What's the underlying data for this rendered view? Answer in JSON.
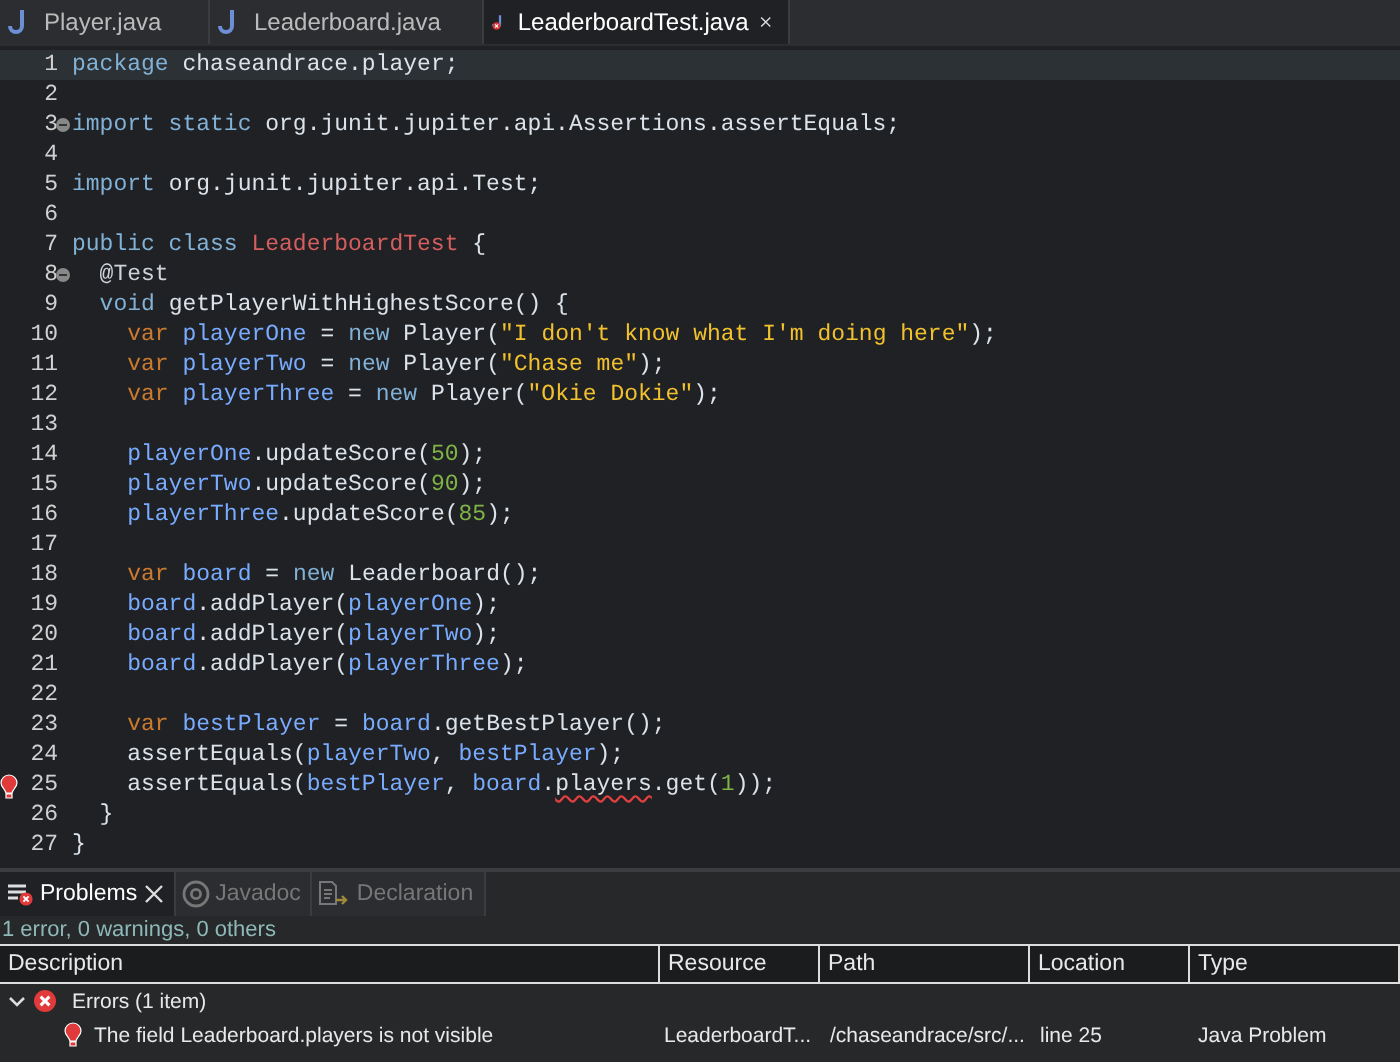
{
  "editor_tabs": [
    {
      "label": "Player.java",
      "selected": false,
      "has_error": false
    },
    {
      "label": "Leaderboard.java",
      "selected": false,
      "has_error": false
    },
    {
      "label": "LeaderboardTest.java",
      "selected": true,
      "has_error": true
    }
  ],
  "code_lines": [
    {
      "no": "1",
      "current": true,
      "foldable": false,
      "has_error": false,
      "tokens": [
        {
          "t": "package ",
          "kind": "keyword"
        },
        {
          "t": "chaseandrace.player;",
          "kind": "plain"
        }
      ]
    },
    {
      "no": "2",
      "current": false,
      "foldable": false,
      "has_error": false
    },
    {
      "no": "3",
      "current": false,
      "foldable": true,
      "has_error": false,
      "tokens": [
        {
          "t": "import static ",
          "kind": "keyword"
        },
        {
          "t": "org.junit.jupiter.api.Assertions.assertEquals;",
          "kind": "plain"
        }
      ]
    },
    {
      "no": "4",
      "current": false,
      "foldable": false,
      "has_error": false
    },
    {
      "no": "5",
      "current": false,
      "foldable": false,
      "has_error": false,
      "tokens": [
        {
          "t": "import ",
          "kind": "keyword"
        },
        {
          "t": "org.junit.jupiter.api.Test;",
          "kind": "plain"
        }
      ]
    },
    {
      "no": "6",
      "current": false,
      "foldable": false,
      "has_error": false
    },
    {
      "no": "7",
      "current": false,
      "foldable": false,
      "has_error": false,
      "tokens": [
        {
          "t": "public class ",
          "kind": "keyword"
        },
        {
          "t": "LeaderboardTest",
          "kind": "class"
        },
        {
          "t": " {",
          "kind": "plain"
        }
      ]
    },
    {
      "no": "8",
      "current": false,
      "foldable": true,
      "has_error": false,
      "tokens": [
        {
          "t": "  @Test",
          "kind": "annotation"
        }
      ]
    },
    {
      "no": "9",
      "current": false,
      "foldable": false,
      "has_error": false,
      "tokens": [
        {
          "t": "  void ",
          "kind": "keyword"
        },
        {
          "t": "getPlayerWithHighestScore() {",
          "kind": "plain"
        }
      ]
    },
    {
      "no": "10",
      "current": false,
      "foldable": false,
      "has_error": false,
      "tokens": [
        {
          "t": "    var ",
          "kind": "var"
        },
        {
          "t": "playerOne",
          "kind": "local"
        },
        {
          "t": " = ",
          "kind": "plain"
        },
        {
          "t": "new ",
          "kind": "keyword"
        },
        {
          "t": "Player(",
          "kind": "plain"
        },
        {
          "t": "\"I don't know what I'm doing here\"",
          "kind": "string"
        },
        {
          "t": ");",
          "kind": "plain"
        }
      ]
    },
    {
      "no": "11",
      "current": false,
      "foldable": false,
      "has_error": false,
      "tokens": [
        {
          "t": "    var ",
          "kind": "var"
        },
        {
          "t": "playerTwo",
          "kind": "local"
        },
        {
          "t": " = ",
          "kind": "plain"
        },
        {
          "t": "new ",
          "kind": "keyword"
        },
        {
          "t": "Player(",
          "kind": "plain"
        },
        {
          "t": "\"Chase me\"",
          "kind": "string"
        },
        {
          "t": ");",
          "kind": "plain"
        }
      ]
    },
    {
      "no": "12",
      "current": false,
      "foldable": false,
      "has_error": false,
      "tokens": [
        {
          "t": "    var ",
          "kind": "var"
        },
        {
          "t": "playerThree",
          "kind": "local"
        },
        {
          "t": " = ",
          "kind": "plain"
        },
        {
          "t": "new ",
          "kind": "keyword"
        },
        {
          "t": "Player(",
          "kind": "plain"
        },
        {
          "t": "\"Okie Dokie\"",
          "kind": "string"
        },
        {
          "t": ");",
          "kind": "plain"
        }
      ]
    },
    {
      "no": "13",
      "current": false,
      "foldable": false,
      "has_error": false
    },
    {
      "no": "14",
      "current": false,
      "foldable": false,
      "has_error": false,
      "tokens": [
        {
          "t": "    playerOne",
          "kind": "local"
        },
        {
          "t": ".updateScore(",
          "kind": "plain"
        },
        {
          "t": "50",
          "kind": "number"
        },
        {
          "t": ");",
          "kind": "plain"
        }
      ]
    },
    {
      "no": "15",
      "current": false,
      "foldable": false,
      "has_error": false,
      "tokens": [
        {
          "t": "    playerTwo",
          "kind": "local"
        },
        {
          "t": ".updateScore(",
          "kind": "plain"
        },
        {
          "t": "90",
          "kind": "number"
        },
        {
          "t": ");",
          "kind": "plain"
        }
      ]
    },
    {
      "no": "16",
      "current": false,
      "foldable": false,
      "has_error": false,
      "tokens": [
        {
          "t": "    playerThree",
          "kind": "local"
        },
        {
          "t": ".updateScore(",
          "kind": "plain"
        },
        {
          "t": "85",
          "kind": "number"
        },
        {
          "t": ");",
          "kind": "plain"
        }
      ]
    },
    {
      "no": "17",
      "current": false,
      "foldable": false,
      "has_error": false
    },
    {
      "no": "18",
      "current": false,
      "foldable": false,
      "has_error": false,
      "tokens": [
        {
          "t": "    var ",
          "kind": "var"
        },
        {
          "t": "board",
          "kind": "local"
        },
        {
          "t": " = ",
          "kind": "plain"
        },
        {
          "t": "new ",
          "kind": "keyword"
        },
        {
          "t": "Leaderboard();",
          "kind": "plain"
        }
      ]
    },
    {
      "no": "19",
      "current": false,
      "foldable": false,
      "has_error": false,
      "tokens": [
        {
          "t": "    board",
          "kind": "local"
        },
        {
          "t": ".addPlayer(",
          "kind": "plain"
        },
        {
          "t": "playerOne",
          "kind": "local"
        },
        {
          "t": ");",
          "kind": "plain"
        }
      ]
    },
    {
      "no": "20",
      "current": false,
      "foldable": false,
      "has_error": false,
      "tokens": [
        {
          "t": "    board",
          "kind": "local"
        },
        {
          "t": ".addPlayer(",
          "kind": "plain"
        },
        {
          "t": "playerTwo",
          "kind": "local"
        },
        {
          "t": ");",
          "kind": "plain"
        }
      ]
    },
    {
      "no": "21",
      "current": false,
      "foldable": false,
      "has_error": false,
      "tokens": [
        {
          "t": "    board",
          "kind": "local"
        },
        {
          "t": ".addPlayer(",
          "kind": "plain"
        },
        {
          "t": "playerThree",
          "kind": "local"
        },
        {
          "t": ");",
          "kind": "plain"
        }
      ]
    },
    {
      "no": "22",
      "current": false,
      "foldable": false,
      "has_error": false
    },
    {
      "no": "23",
      "current": false,
      "foldable": false,
      "has_error": false,
      "tokens": [
        {
          "t": "    var ",
          "kind": "var"
        },
        {
          "t": "bestPlayer",
          "kind": "local"
        },
        {
          "t": " = ",
          "kind": "plain"
        },
        {
          "t": "board",
          "kind": "local"
        },
        {
          "t": ".getBestPlayer();",
          "kind": "plain"
        }
      ]
    },
    {
      "no": "24",
      "current": false,
      "foldable": false,
      "has_error": false,
      "tokens": [
        {
          "t": "    assertEquals(",
          "kind": "plain"
        },
        {
          "t": "playerTwo",
          "kind": "local"
        },
        {
          "t": ", ",
          "kind": "plain"
        },
        {
          "t": "bestPlayer",
          "kind": "local"
        },
        {
          "t": ");",
          "kind": "plain"
        }
      ]
    },
    {
      "no": "25",
      "current": false,
      "foldable": false,
      "has_error": true,
      "tokens": [
        {
          "t": "    assertEquals(",
          "kind": "plain"
        },
        {
          "t": "bestPlayer",
          "kind": "local"
        },
        {
          "t": ", ",
          "kind": "plain"
        },
        {
          "t": "board",
          "kind": "local"
        },
        {
          "t": ".",
          "kind": "plain"
        },
        {
          "t": "players",
          "kind": "error"
        },
        {
          "t": ".get(",
          "kind": "plain"
        },
        {
          "t": "1",
          "kind": "number"
        },
        {
          "t": "));",
          "kind": "plain"
        }
      ]
    },
    {
      "no": "26",
      "current": false,
      "foldable": false,
      "has_error": false,
      "tokens": [
        {
          "t": "  }",
          "kind": "plain"
        }
      ]
    },
    {
      "no": "27",
      "current": false,
      "foldable": false,
      "has_error": false,
      "tokens": [
        {
          "t": "}",
          "kind": "plain"
        }
      ]
    }
  ],
  "panel_tabs": [
    {
      "label": "Problems",
      "kind": "problems",
      "selected": true,
      "disabled": false
    },
    {
      "label": "Javadoc",
      "kind": "javadoc",
      "selected": false,
      "disabled": true
    },
    {
      "label": "Declaration",
      "kind": "declaration",
      "selected": false,
      "disabled": true
    }
  ],
  "summary": "1 error, 0 warnings, 0 others",
  "table": {
    "columns": [
      "Description",
      "Resource",
      "Path",
      "Location",
      "Type"
    ],
    "groups": [
      {
        "label": "Errors (1 item)",
        "expanded": true,
        "rows": [
          {
            "description": "The field Leaderboard.players is not visible",
            "resource": "LeaderboardT...",
            "path": "/chaseandrace/src/...",
            "location": "line 25",
            "type": "Java Problem"
          }
        ]
      }
    ]
  }
}
